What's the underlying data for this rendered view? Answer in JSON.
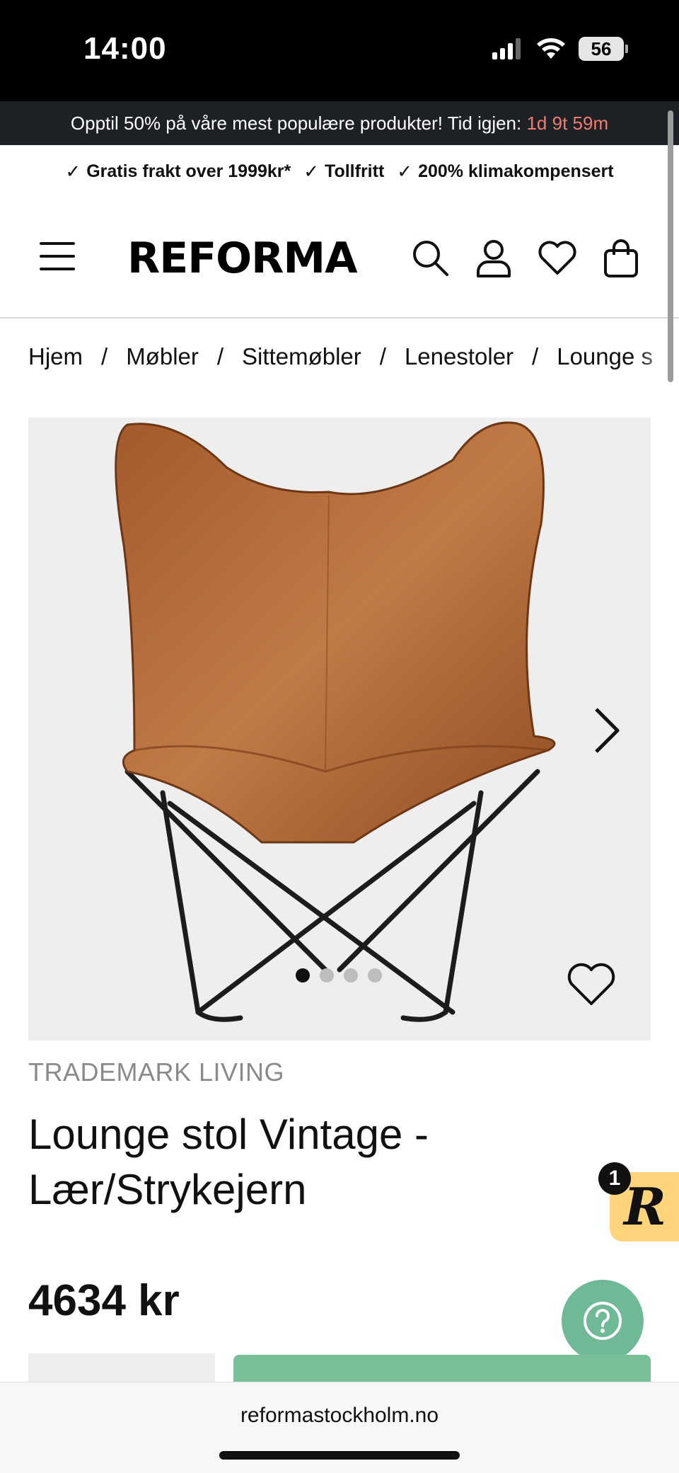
{
  "status_bar": {
    "time": "14:00",
    "battery": "56",
    "icons": [
      "signal-icon",
      "wifi-icon",
      "battery-icon"
    ]
  },
  "promo": {
    "text": "Opptil 50% på våre mest populære produkter! Tid igjen:",
    "timer": "1d 9t 59m",
    "timer_color": "#ef7c6f"
  },
  "usp": [
    {
      "label": "Gratis frakt over 1999kr*"
    },
    {
      "label": "Tollfritt"
    },
    {
      "label": "200% klimakompensert"
    }
  ],
  "header": {
    "logo": "REFORMA",
    "icons": [
      "menu-icon",
      "search-icon",
      "account-icon",
      "wishlist-icon",
      "cart-icon"
    ]
  },
  "breadcrumb": [
    "Hjem",
    "Møbler",
    "Sittemøbler",
    "Lenestoler",
    "Lounge s"
  ],
  "gallery": {
    "image_count": 4,
    "active_index": 0,
    "background": "#eeeeef"
  },
  "product": {
    "brand": "TRADEMARK LIVING",
    "title": "Lounge stol Vintage - Lær/Strykejern",
    "price": "4634 kr"
  },
  "widgets": {
    "rewards_letter": "R",
    "rewards_badge": "1",
    "rewards_color": "#ffd47a",
    "help_color": "#6fb996"
  },
  "browser": {
    "url": "reformastockholm.no"
  },
  "colors": {
    "accent_green": "#78bf97",
    "banner_bg": "#1d2125"
  }
}
